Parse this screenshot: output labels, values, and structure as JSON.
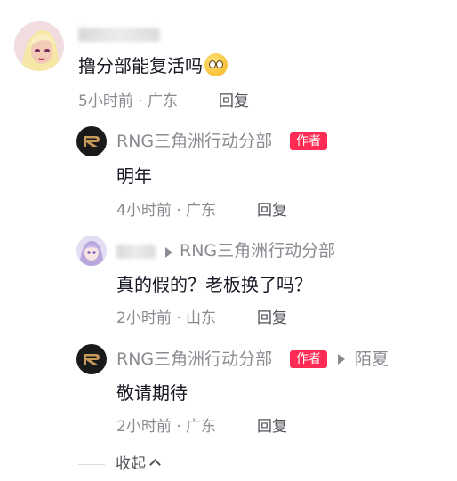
{
  "main_comment": {
    "content": "撸分部能复活吗",
    "emoji": "pleading-face-emoji",
    "time": "5小时前",
    "location": "广东",
    "reply_label": "回复"
  },
  "replies": [
    {
      "author": "RNG三角洲行动分部",
      "badge": "作者",
      "content": "明年",
      "time": "4小时前",
      "location": "广东",
      "reply_label": "回复"
    },
    {
      "reply_to": "RNG三角洲行动分部",
      "content": "真的假的？老板换了吗？",
      "time": "2小时前",
      "location": "山东",
      "reply_label": "回复"
    },
    {
      "author": "RNG三角洲行动分部",
      "badge": "作者",
      "reply_to": "陌夏",
      "content": "敬请期待",
      "time": "2小时前",
      "location": "广东",
      "reply_label": "回复"
    }
  ],
  "collapse_label": "收起",
  "colors": {
    "badge": "#fe2c55",
    "meta": "#8a8b91"
  }
}
